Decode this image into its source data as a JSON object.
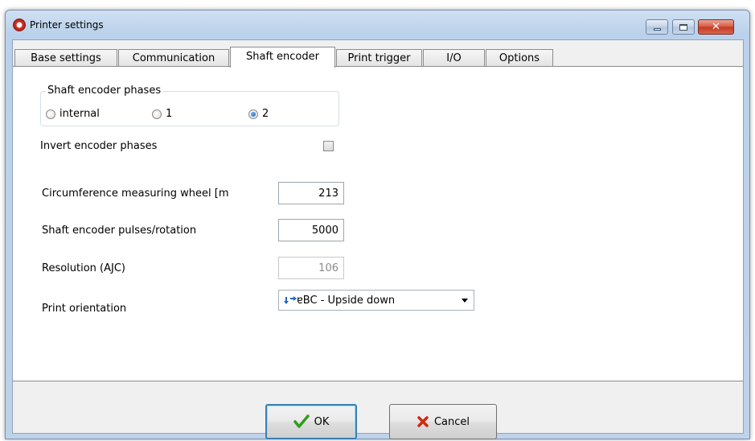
{
  "window": {
    "title": "Printer settings",
    "buttons": [
      "minimize",
      "maximize",
      "close"
    ]
  },
  "tabs": [
    {
      "label": "Base settings",
      "active": false
    },
    {
      "label": "Communication",
      "active": false
    },
    {
      "label": "Shaft encoder",
      "active": true
    },
    {
      "label": "Print trigger",
      "active": false
    },
    {
      "label": "I/O",
      "active": false
    },
    {
      "label": "Options",
      "active": false
    }
  ],
  "shaft_encoder": {
    "phases_group": {
      "legend": "Shaft encoder phases",
      "options": [
        {
          "label": "internal",
          "checked": false
        },
        {
          "label": "1",
          "checked": false
        },
        {
          "label": "2",
          "checked": true
        }
      ]
    },
    "invert_phases": {
      "label": "Invert encoder phases",
      "checked": false
    },
    "circumference": {
      "label": "Circumference measuring wheel [m",
      "value": "213"
    },
    "pulses": {
      "label": "Shaft encoder pulses/rotation",
      "value": "5000"
    },
    "resolution": {
      "label": "Resolution (AJC)",
      "value": "106"
    },
    "print_orientation": {
      "label": "Print orientation",
      "value": "ABC - Upside down",
      "display_value": "ɐBC - Upside down"
    }
  },
  "footer": {
    "ok_label": "OK",
    "cancel_label": "Cancel"
  },
  "colors": {
    "ok_check": "#2e9e1d",
    "cancel_x": "#d12a10",
    "selection_blue": "#1a5fb4"
  }
}
